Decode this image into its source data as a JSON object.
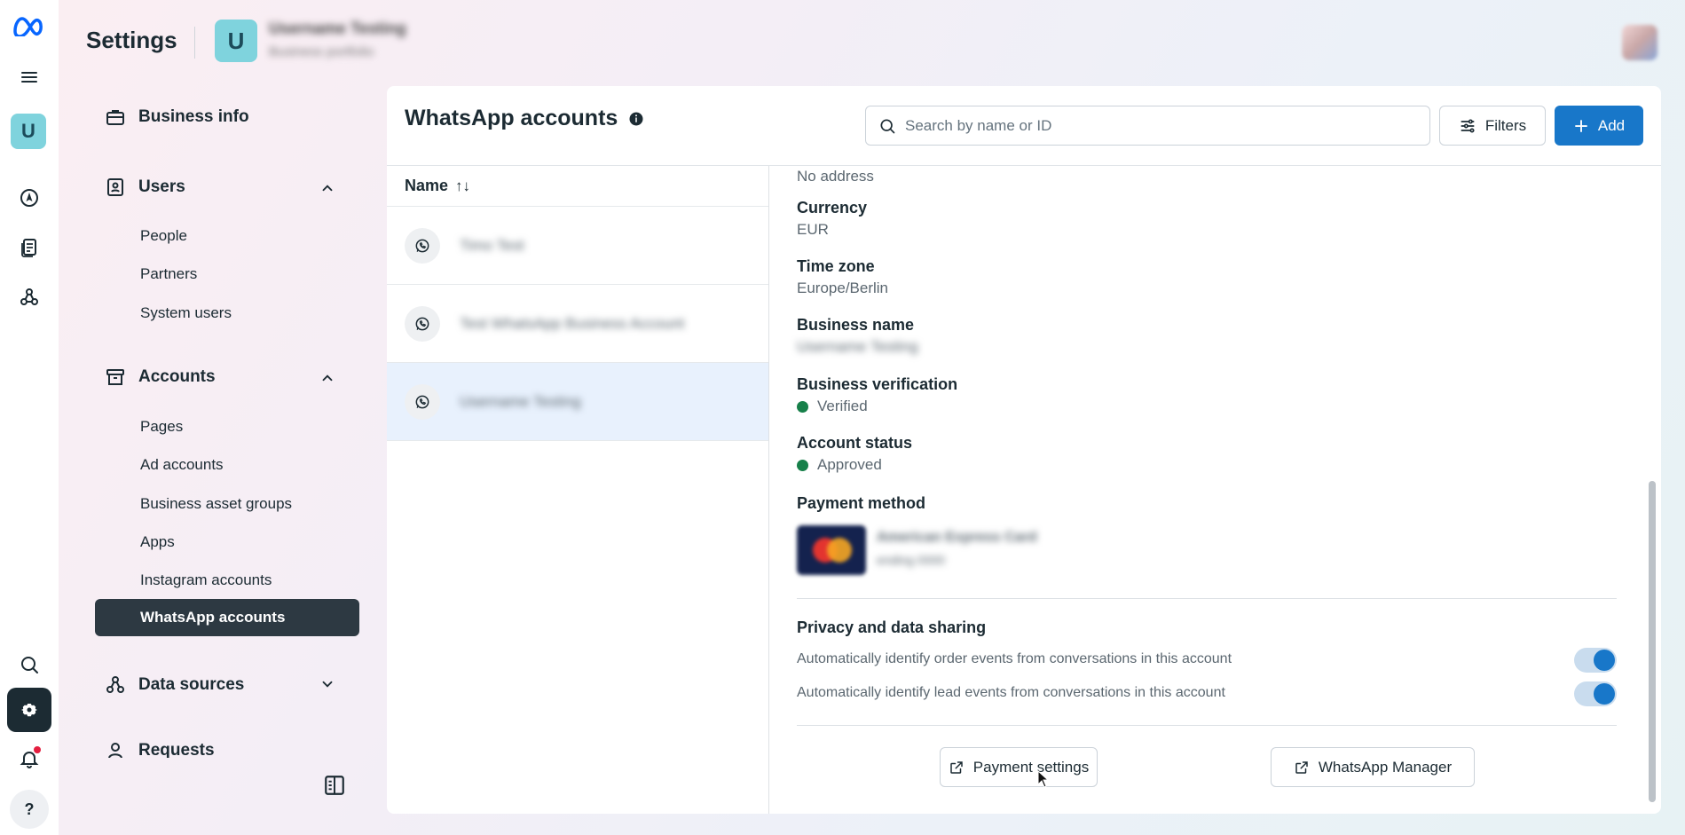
{
  "header": {
    "title": "Settings",
    "business_initial": "U",
    "business_name": "Username Testing",
    "business_sub": "Business portfolio"
  },
  "rail": {
    "avatar_initial": "U",
    "help": "?"
  },
  "sidebar": {
    "business_info": "Business info",
    "users": {
      "label": "Users",
      "items": [
        "People",
        "Partners",
        "System users"
      ]
    },
    "accounts": {
      "label": "Accounts",
      "items": [
        "Pages",
        "Ad accounts",
        "Business asset groups",
        "Apps",
        "Instagram accounts"
      ],
      "active": "WhatsApp accounts"
    },
    "data_sources": "Data sources",
    "requests": "Requests"
  },
  "main": {
    "title": "WhatsApp accounts",
    "search_placeholder": "Search by name or ID",
    "filters_label": "Filters",
    "add_label": "Add",
    "list": {
      "column_name": "Name",
      "sort_icon": "↑↓",
      "rows": [
        {
          "name": "Timo Test"
        },
        {
          "name": "Test WhatsApp Business Account"
        },
        {
          "name": "Username Testing"
        }
      ]
    },
    "detail": {
      "address_value": "No address",
      "currency_label": "Currency",
      "currency_value": "EUR",
      "timezone_label": "Time zone",
      "timezone_value": "Europe/Berlin",
      "business_name_label": "Business name",
      "business_name_value": "Username Testing",
      "verification_label": "Business verification",
      "verification_value": "Verified",
      "account_status_label": "Account status",
      "account_status_value": "Approved",
      "payment_label": "Payment method",
      "payment_card_name": "American Express Card",
      "payment_card_sub": "ending 0000",
      "privacy_title": "Privacy and data sharing",
      "privacy_order": "Automatically identify order events from conversations in this account",
      "privacy_lead": "Automatically identify lead events from conversations in this account",
      "payment_settings_btn": "Payment settings",
      "whatsapp_manager_btn": "WhatsApp Manager"
    }
  },
  "colors": {
    "accent": "#1877c9",
    "active_nav": "#2d3942",
    "status_green": "#17804a",
    "selected_row": "#e8f1fd"
  }
}
